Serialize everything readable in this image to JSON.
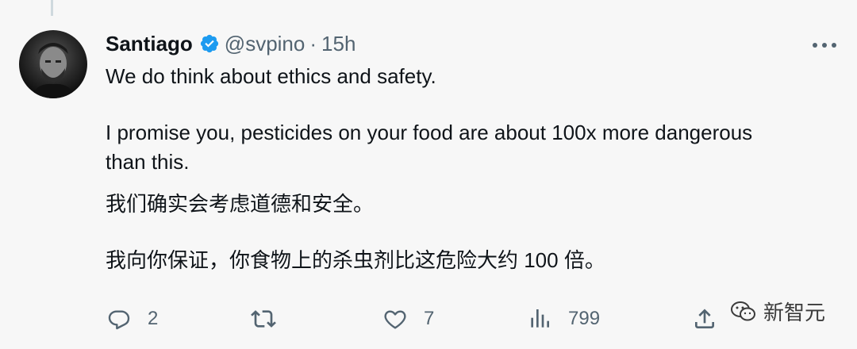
{
  "tweet": {
    "author_name": "Santiago",
    "handle": "@svpino",
    "separator": "·",
    "time": "15h",
    "lines": [
      "We do think about ethics and safety.",
      "I promise you, pesticides on your food are about 100x more dangerous",
      "than this.",
      "我们确实会考虑道德和安全。",
      "我向你保证，你食物上的杀虫剂比这危险大约 100 倍。"
    ]
  },
  "actions": {
    "reply_count": "2",
    "retweet_count": "",
    "like_count": "7",
    "views_count": "799"
  },
  "watermark": {
    "text": "新智元"
  },
  "colors": {
    "background": "#f7f7f7",
    "text": "#0f1419",
    "secondary": "#536471",
    "verified": "#1d9bf0"
  },
  "icons": [
    "verified-badge-icon",
    "more-icon",
    "reply-icon",
    "retweet-icon",
    "like-icon",
    "views-icon",
    "share-icon",
    "wechat-icon"
  ]
}
